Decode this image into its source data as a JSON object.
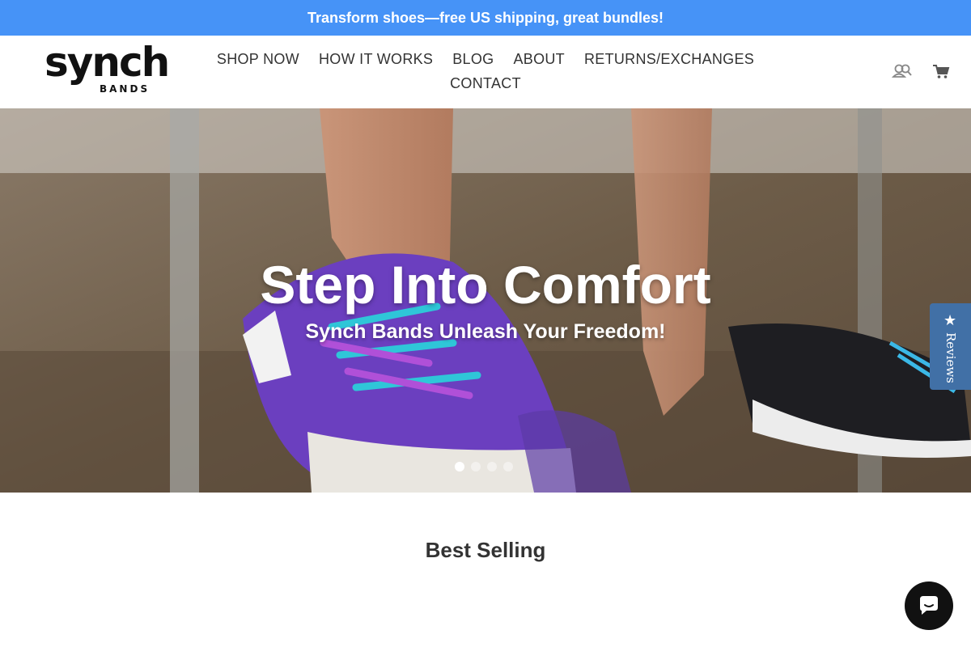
{
  "announcement": {
    "text": "Transform shoes—free US shipping, great bundles!",
    "bg_color": "#4693f7"
  },
  "logo": {
    "word": "synch",
    "sub": "BANDS"
  },
  "nav": {
    "items": [
      {
        "label": "SHOP NOW"
      },
      {
        "label": "HOW IT WORKS"
      },
      {
        "label": "BLOG"
      },
      {
        "label": "ABOUT"
      },
      {
        "label": "RETURNS/EXCHANGES"
      },
      {
        "label": "CONTACT"
      }
    ]
  },
  "header_icons": {
    "account": "account-icon",
    "cart": "cart-icon"
  },
  "hero": {
    "title": "Step Into Comfort",
    "subtitle": "Synch Bands Unleash Your Freedom!",
    "slides": 4,
    "active_slide": 1
  },
  "reviews_tab": {
    "label": "Reviews",
    "icon": "star-icon",
    "color": "#4170a6"
  },
  "section": {
    "title": "Best Selling"
  },
  "chat": {
    "icon": "chat-bubble-icon"
  }
}
